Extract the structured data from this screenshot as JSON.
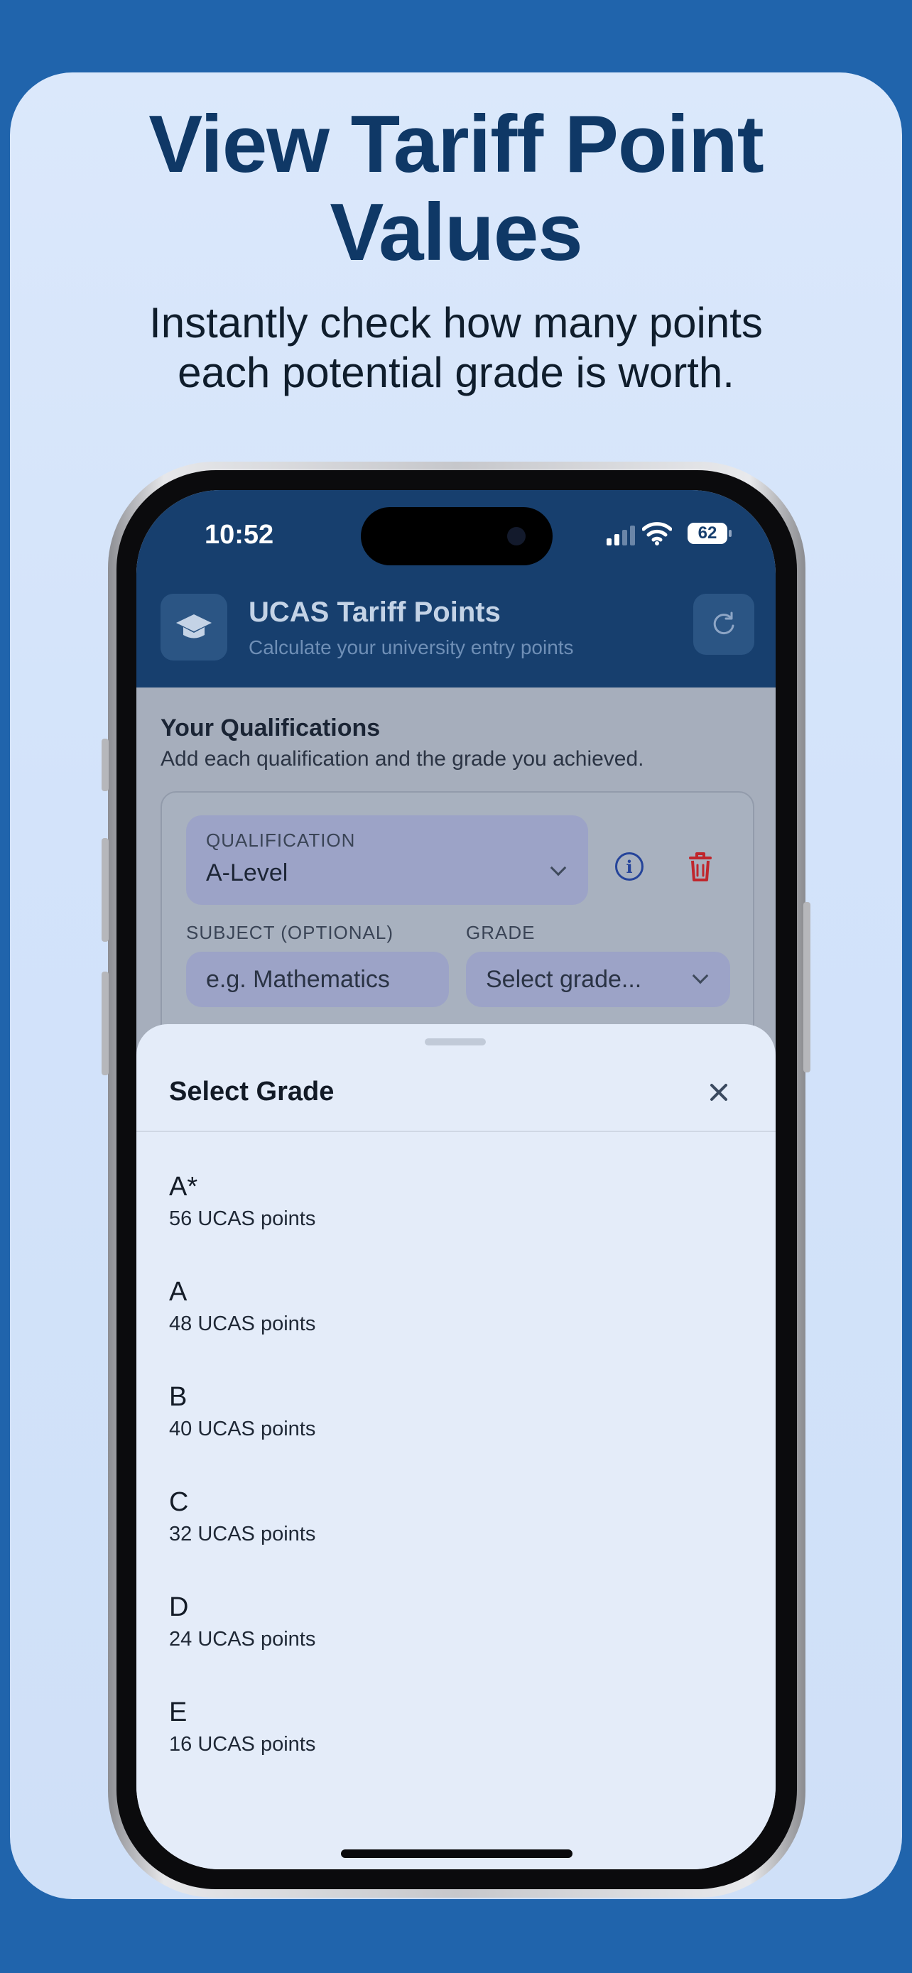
{
  "headline": {
    "line1": "View Tariff Point",
    "line2": "Values"
  },
  "subline": {
    "line1": "Instantly check how many points",
    "line2": "each potential grade is worth."
  },
  "status_bar": {
    "time": "10:52",
    "battery": "62"
  },
  "app_header": {
    "title": "UCAS Tariff Points",
    "subtitle": "Calculate your university entry points",
    "logo_icon": "graduation-cap-icon",
    "refresh_icon": "refresh-icon"
  },
  "qualifications": {
    "title": "Your Qualifications",
    "subtitle": "Add each qualification and the grade you achieved.",
    "qualification_label": "QUALIFICATION",
    "qualification_value": "A-Level",
    "subject_label": "SUBJECT (OPTIONAL)",
    "subject_placeholder": "e.g. Mathematics",
    "grade_label": "GRADE",
    "grade_placeholder": "Select grade..."
  },
  "sheet": {
    "title": "Select Grade",
    "grades": [
      {
        "grade": "A*",
        "points": "56 UCAS points"
      },
      {
        "grade": "A",
        "points": "48 UCAS points"
      },
      {
        "grade": "B",
        "points": "40 UCAS points"
      },
      {
        "grade": "C",
        "points": "32 UCAS points"
      },
      {
        "grade": "D",
        "points": "24 UCAS points"
      },
      {
        "grade": "E",
        "points": "16 UCAS points"
      }
    ]
  },
  "colors": {
    "background": "#2064ac",
    "headline": "#0f3866",
    "app_header": "#173f6e",
    "delete_red": "#c0262c",
    "info_blue": "#25449a"
  }
}
